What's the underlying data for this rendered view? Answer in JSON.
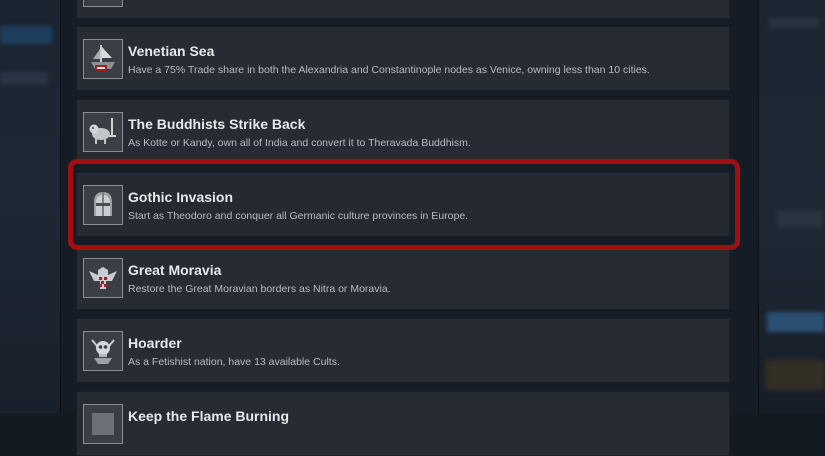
{
  "achievements": [
    {
      "title": "",
      "description": "",
      "icon": "achievement-icon-partial"
    },
    {
      "title": "Venetian Sea",
      "description": "Have a 75% Trade share in both the Alexandria and Constantinople nodes as Venice, owning less than 10 cities.",
      "icon": "ship-icon"
    },
    {
      "title": "The Buddhists Strike Back",
      "description": "As Kotte or Kandy, own all of India and convert it to Theravada Buddhism.",
      "icon": "lion-sword-icon"
    },
    {
      "title": "Gothic Invasion",
      "description": "Start as Theodoro and conquer all Germanic culture provinces in Europe.",
      "icon": "helmet-icon"
    },
    {
      "title": "Great Moravia",
      "description": "Restore the Great Moravian borders as Nitra or Moravia.",
      "icon": "eagle-icon"
    },
    {
      "title": "Hoarder",
      "description": "As a Fetishist nation, have 13 available Cults.",
      "icon": "skull-totem-icon"
    },
    {
      "title": "Keep the Flame Burning",
      "description": "",
      "icon": "achievement-icon-partial"
    }
  ],
  "highlight_color": "#a10f14"
}
